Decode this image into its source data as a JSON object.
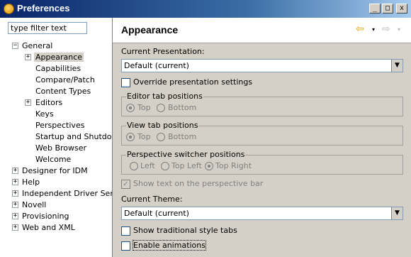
{
  "window": {
    "title": "Preferences",
    "minimize": "_",
    "maximize": "□",
    "close": "x"
  },
  "filter": {
    "placeholder": "type filter text"
  },
  "tree": {
    "items": [
      {
        "label": "General",
        "expander": "−"
      },
      {
        "label": "Appearance",
        "expander": "+"
      },
      {
        "label": "Capabilities"
      },
      {
        "label": "Compare/Patch"
      },
      {
        "label": "Content Types"
      },
      {
        "label": "Editors",
        "expander": "+"
      },
      {
        "label": "Keys"
      },
      {
        "label": "Perspectives"
      },
      {
        "label": "Startup and Shutdown"
      },
      {
        "label": "Web Browser"
      },
      {
        "label": "Welcome"
      },
      {
        "label": "Designer for IDM",
        "expander": "+"
      },
      {
        "label": "Help",
        "expander": "+"
      },
      {
        "label": "Independent Driver Servic",
        "expander": "+"
      },
      {
        "label": "Novell",
        "expander": "+"
      },
      {
        "label": "Provisioning",
        "expander": "+"
      },
      {
        "label": "Web and XML",
        "expander": "+"
      }
    ],
    "selected": "Appearance"
  },
  "page": {
    "title": "Appearance",
    "back_glyph": "⇦",
    "drop_glyph": "▾",
    "forward_glyph": "⇨",
    "current_presentation_label": "Current Presentation:",
    "current_presentation_value": "Default (current)",
    "override_label": "Override presentation settings",
    "editor_tab_positions": {
      "title": "Editor tab positions",
      "top": "Top",
      "bottom": "Bottom"
    },
    "view_tab_positions": {
      "title": "View tab positions",
      "top": "Top",
      "bottom": "Bottom"
    },
    "perspective_switcher": {
      "title": "Perspective switcher positions",
      "left": "Left",
      "top_left": "Top Left",
      "top_right": "Top Right"
    },
    "show_text_label": "Show text on the perspective bar",
    "current_theme_label": "Current Theme:",
    "current_theme_value": "Default (current)",
    "traditional_tabs_label": "Show traditional style tabs",
    "animations_label": "Enable animations",
    "combo_arrow": "▼",
    "check_mark": "✓"
  }
}
